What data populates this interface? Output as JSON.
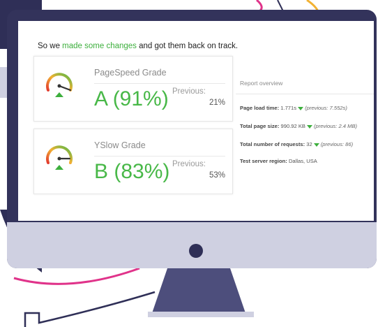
{
  "screen": {
    "headline": {
      "before": "So we ",
      "highlight": "made some changes",
      "after": " and got them back on track."
    },
    "cards": [
      {
        "title": "PageSpeed Grade",
        "grade": "A (91%)",
        "previous_label": "Previous:",
        "previous_value": "21%"
      },
      {
        "title": "YSlow Grade",
        "grade": "B (83%)",
        "previous_label": "Previous:",
        "previous_value": "53%"
      }
    ],
    "report": {
      "title": "Report overview",
      "rows": [
        {
          "label": "Page load time:",
          "value": "1.771s",
          "previous": "(previous: 7.552s)"
        },
        {
          "label": "Total page size:",
          "value": "990.92 KB",
          "previous": "(previous: 2.4 MB)"
        },
        {
          "label": "Total number of requests:",
          "value": "32",
          "previous": "(previous: 86)"
        },
        {
          "label": "Test server region:",
          "value": "Dallas, USA",
          "previous": ""
        }
      ]
    }
  },
  "colors": {
    "monitor_frame": "#33335b",
    "bezel": "#cfd0e1",
    "accent_green": "#3daf3d",
    "arc_pink": "#e0338a",
    "arc_yellow": "#f2b233"
  },
  "icons": [
    "gauge-icon",
    "down-arrow-icon",
    "power-button-icon"
  ]
}
